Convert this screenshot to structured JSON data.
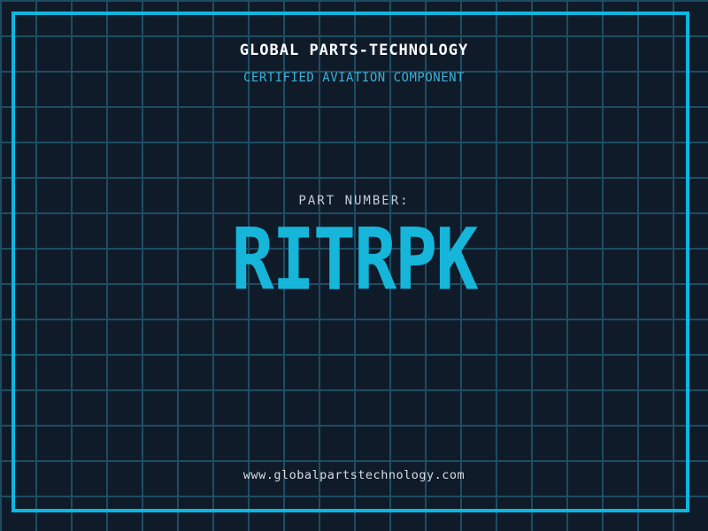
{
  "page": {
    "title": "GLOBAL PARTS-TECHNOLOGY",
    "subtitle": "CERTIFIED AVIATION COMPONENT",
    "part_label": "PART NUMBER:",
    "part_number": "RITRPK",
    "website": "www.globalpartstechnology.com"
  },
  "colors": {
    "background": "#101b2a",
    "grid_line": "#1d4d62",
    "frame_border": "#0bb7e0",
    "accent_cyan": "#16b5da",
    "subtitle_cyan": "#3ab2d6",
    "title_white": "#ffffff",
    "muted_text": "#c6ccd4",
    "website_text": "#d6dbe1"
  }
}
